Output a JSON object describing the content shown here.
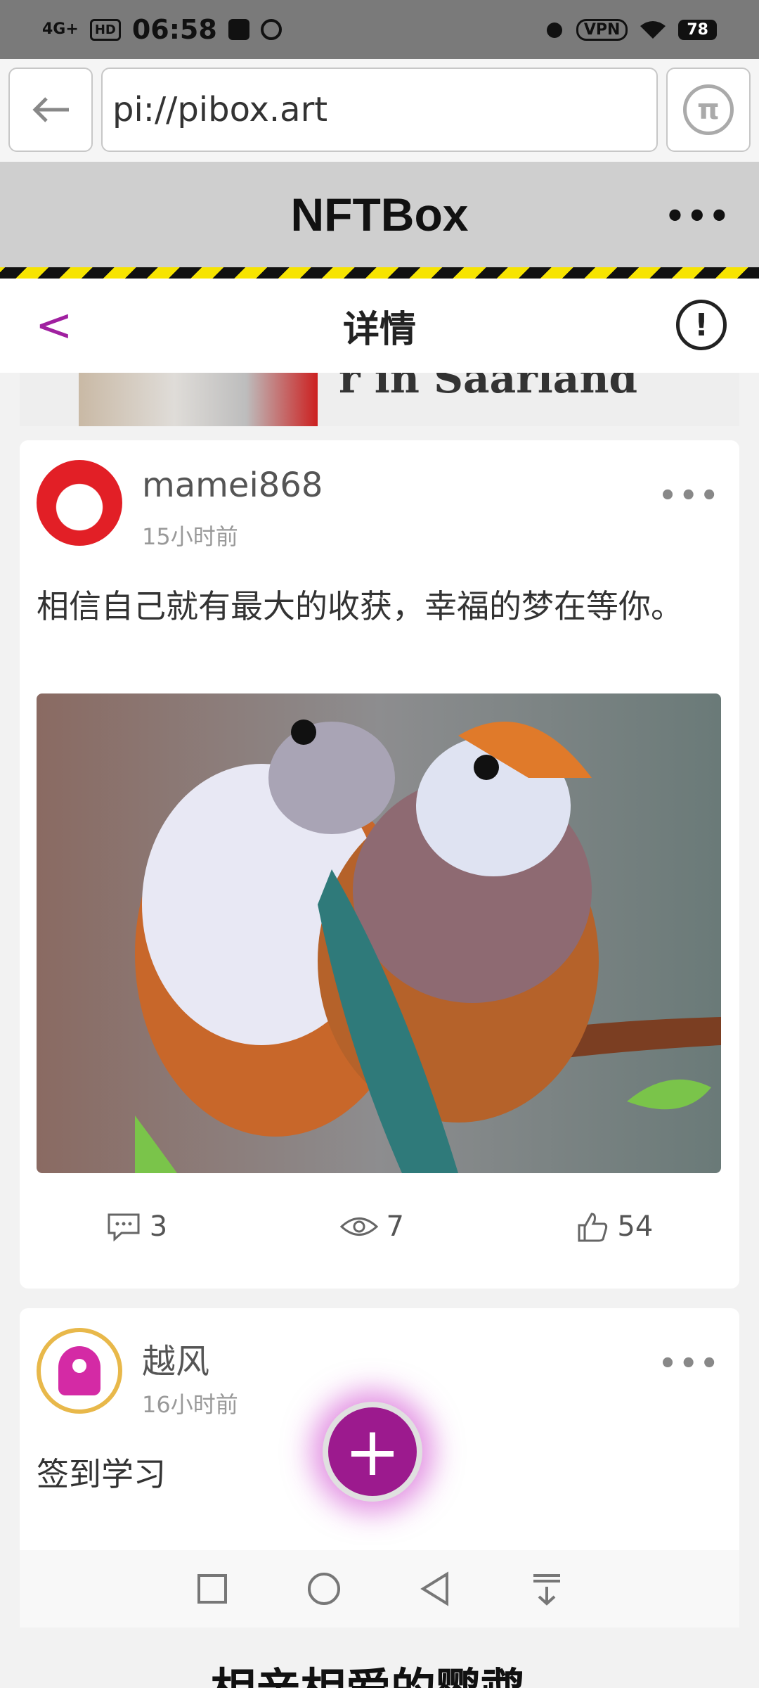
{
  "status_bar": {
    "signal": "4G+",
    "hd": "HD",
    "time": "06:58",
    "vpn": "VPN",
    "battery": "78"
  },
  "browser": {
    "back_icon": "arrow-left-icon",
    "url": "pi://pibox.art",
    "pi_icon": "pi-logo-icon"
  },
  "app_header": {
    "title": "NFTBox",
    "more": "•••"
  },
  "detail_header": {
    "back": "<",
    "title": "详情",
    "info": "!"
  },
  "ad": {
    "text": "r in Saarland"
  },
  "posts": [
    {
      "username": "mamei868",
      "time": "15小时前",
      "more": "•••",
      "text": "相信自己就有最大的收获，幸福的梦在等你。",
      "comments": "3",
      "views": "7",
      "likes": "54"
    },
    {
      "username": "越风",
      "time": "16小时前",
      "more": "•••",
      "text": "签到学习"
    }
  ],
  "fab": {
    "label": "+"
  },
  "bottom_text": "相亲相爱的鹦鹉",
  "colors": {
    "accent": "#9c1a8e",
    "status_bar": "#7a7a7a",
    "header": "#cfcfcf"
  }
}
